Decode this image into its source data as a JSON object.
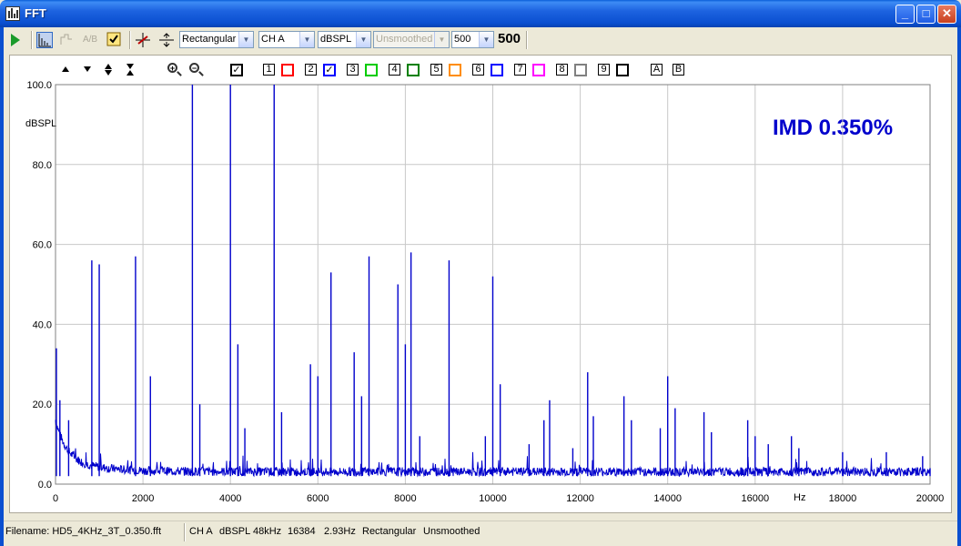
{
  "window": {
    "title": "FFT"
  },
  "toolbar": {
    "window_type": "Rectangular",
    "channel": "CH A",
    "units": "dBSPL",
    "smoothing": "Unsmoothed",
    "averages": "500",
    "average_count": "500"
  },
  "chart_controls": {
    "series_buttons": [
      "1",
      "2",
      "3",
      "4",
      "5",
      "6",
      "7",
      "8",
      "9"
    ],
    "series_colors": [
      "#ff0000",
      "#0000ff",
      "#00cc00",
      "#008000",
      "#ff8c00",
      "#0000ff",
      "#ff00ff",
      "#808080",
      "#000000"
    ],
    "series_checked": [
      false,
      true,
      false,
      false,
      false,
      false,
      false,
      false,
      false
    ],
    "marker_a": "A",
    "marker_b": "B"
  },
  "annotation": {
    "imd": "IMD 0.350%"
  },
  "status": {
    "filename": "Filename: HD5_4KHz_3T_0.350.fft",
    "channel": "CH A",
    "units": "dBSPL",
    "rate": "48kHz",
    "fft_size": "16384",
    "resolution": "2.93Hz",
    "window": "Rectangular",
    "smoothing": "Unsmoothed"
  },
  "chart_data": {
    "type": "line",
    "ylabel": "dBSPL",
    "xlabel": "Hz",
    "xlim": [
      0,
      20000
    ],
    "ylim": [
      0,
      100
    ],
    "x_ticks": [
      "0",
      "2000",
      "4000",
      "6000",
      "8000",
      "10000",
      "12000",
      "14000",
      "16000",
      "18000",
      "20000"
    ],
    "y_ticks": [
      "0.0",
      "20.0",
      "40.0",
      "60.0",
      "80.0",
      "100.0"
    ],
    "grid": true,
    "series_color": "#0000cc",
    "peaks": [
      {
        "x": 20,
        "y": 34
      },
      {
        "x": 100,
        "y": 21
      },
      {
        "x": 300,
        "y": 16
      },
      {
        "x": 830,
        "y": 56
      },
      {
        "x": 1000,
        "y": 55
      },
      {
        "x": 1830,
        "y": 57
      },
      {
        "x": 2170,
        "y": 27
      },
      {
        "x": 3130,
        "y": 100
      },
      {
        "x": 3300,
        "y": 20
      },
      {
        "x": 4000,
        "y": 100
      },
      {
        "x": 4170,
        "y": 35
      },
      {
        "x": 4330,
        "y": 14
      },
      {
        "x": 5000,
        "y": 100
      },
      {
        "x": 5170,
        "y": 18
      },
      {
        "x": 5830,
        "y": 30
      },
      {
        "x": 6000,
        "y": 27
      },
      {
        "x": 6300,
        "y": 53
      },
      {
        "x": 6830,
        "y": 33
      },
      {
        "x": 7000,
        "y": 22
      },
      {
        "x": 7170,
        "y": 57
      },
      {
        "x": 7830,
        "y": 50
      },
      {
        "x": 8000,
        "y": 35
      },
      {
        "x": 8130,
        "y": 58
      },
      {
        "x": 8330,
        "y": 12
      },
      {
        "x": 9000,
        "y": 56
      },
      {
        "x": 9830,
        "y": 12
      },
      {
        "x": 10000,
        "y": 52
      },
      {
        "x": 10170,
        "y": 25
      },
      {
        "x": 10830,
        "y": 10
      },
      {
        "x": 11170,
        "y": 16
      },
      {
        "x": 11300,
        "y": 21
      },
      {
        "x": 11830,
        "y": 9
      },
      {
        "x": 12170,
        "y": 28
      },
      {
        "x": 12300,
        "y": 17
      },
      {
        "x": 13000,
        "y": 22
      },
      {
        "x": 13170,
        "y": 16
      },
      {
        "x": 13830,
        "y": 14
      },
      {
        "x": 14000,
        "y": 27
      },
      {
        "x": 14170,
        "y": 19
      },
      {
        "x": 14830,
        "y": 18
      },
      {
        "x": 15000,
        "y": 13
      },
      {
        "x": 15830,
        "y": 16
      },
      {
        "x": 16000,
        "y": 12
      },
      {
        "x": 16300,
        "y": 10
      },
      {
        "x": 16830,
        "y": 12
      },
      {
        "x": 17000,
        "y": 9
      },
      {
        "x": 18000,
        "y": 8
      },
      {
        "x": 19000,
        "y": 8
      },
      {
        "x": 19830,
        "y": 7
      },
      {
        "x": 20000,
        "y": 4
      }
    ],
    "noise_floor": 2
  }
}
